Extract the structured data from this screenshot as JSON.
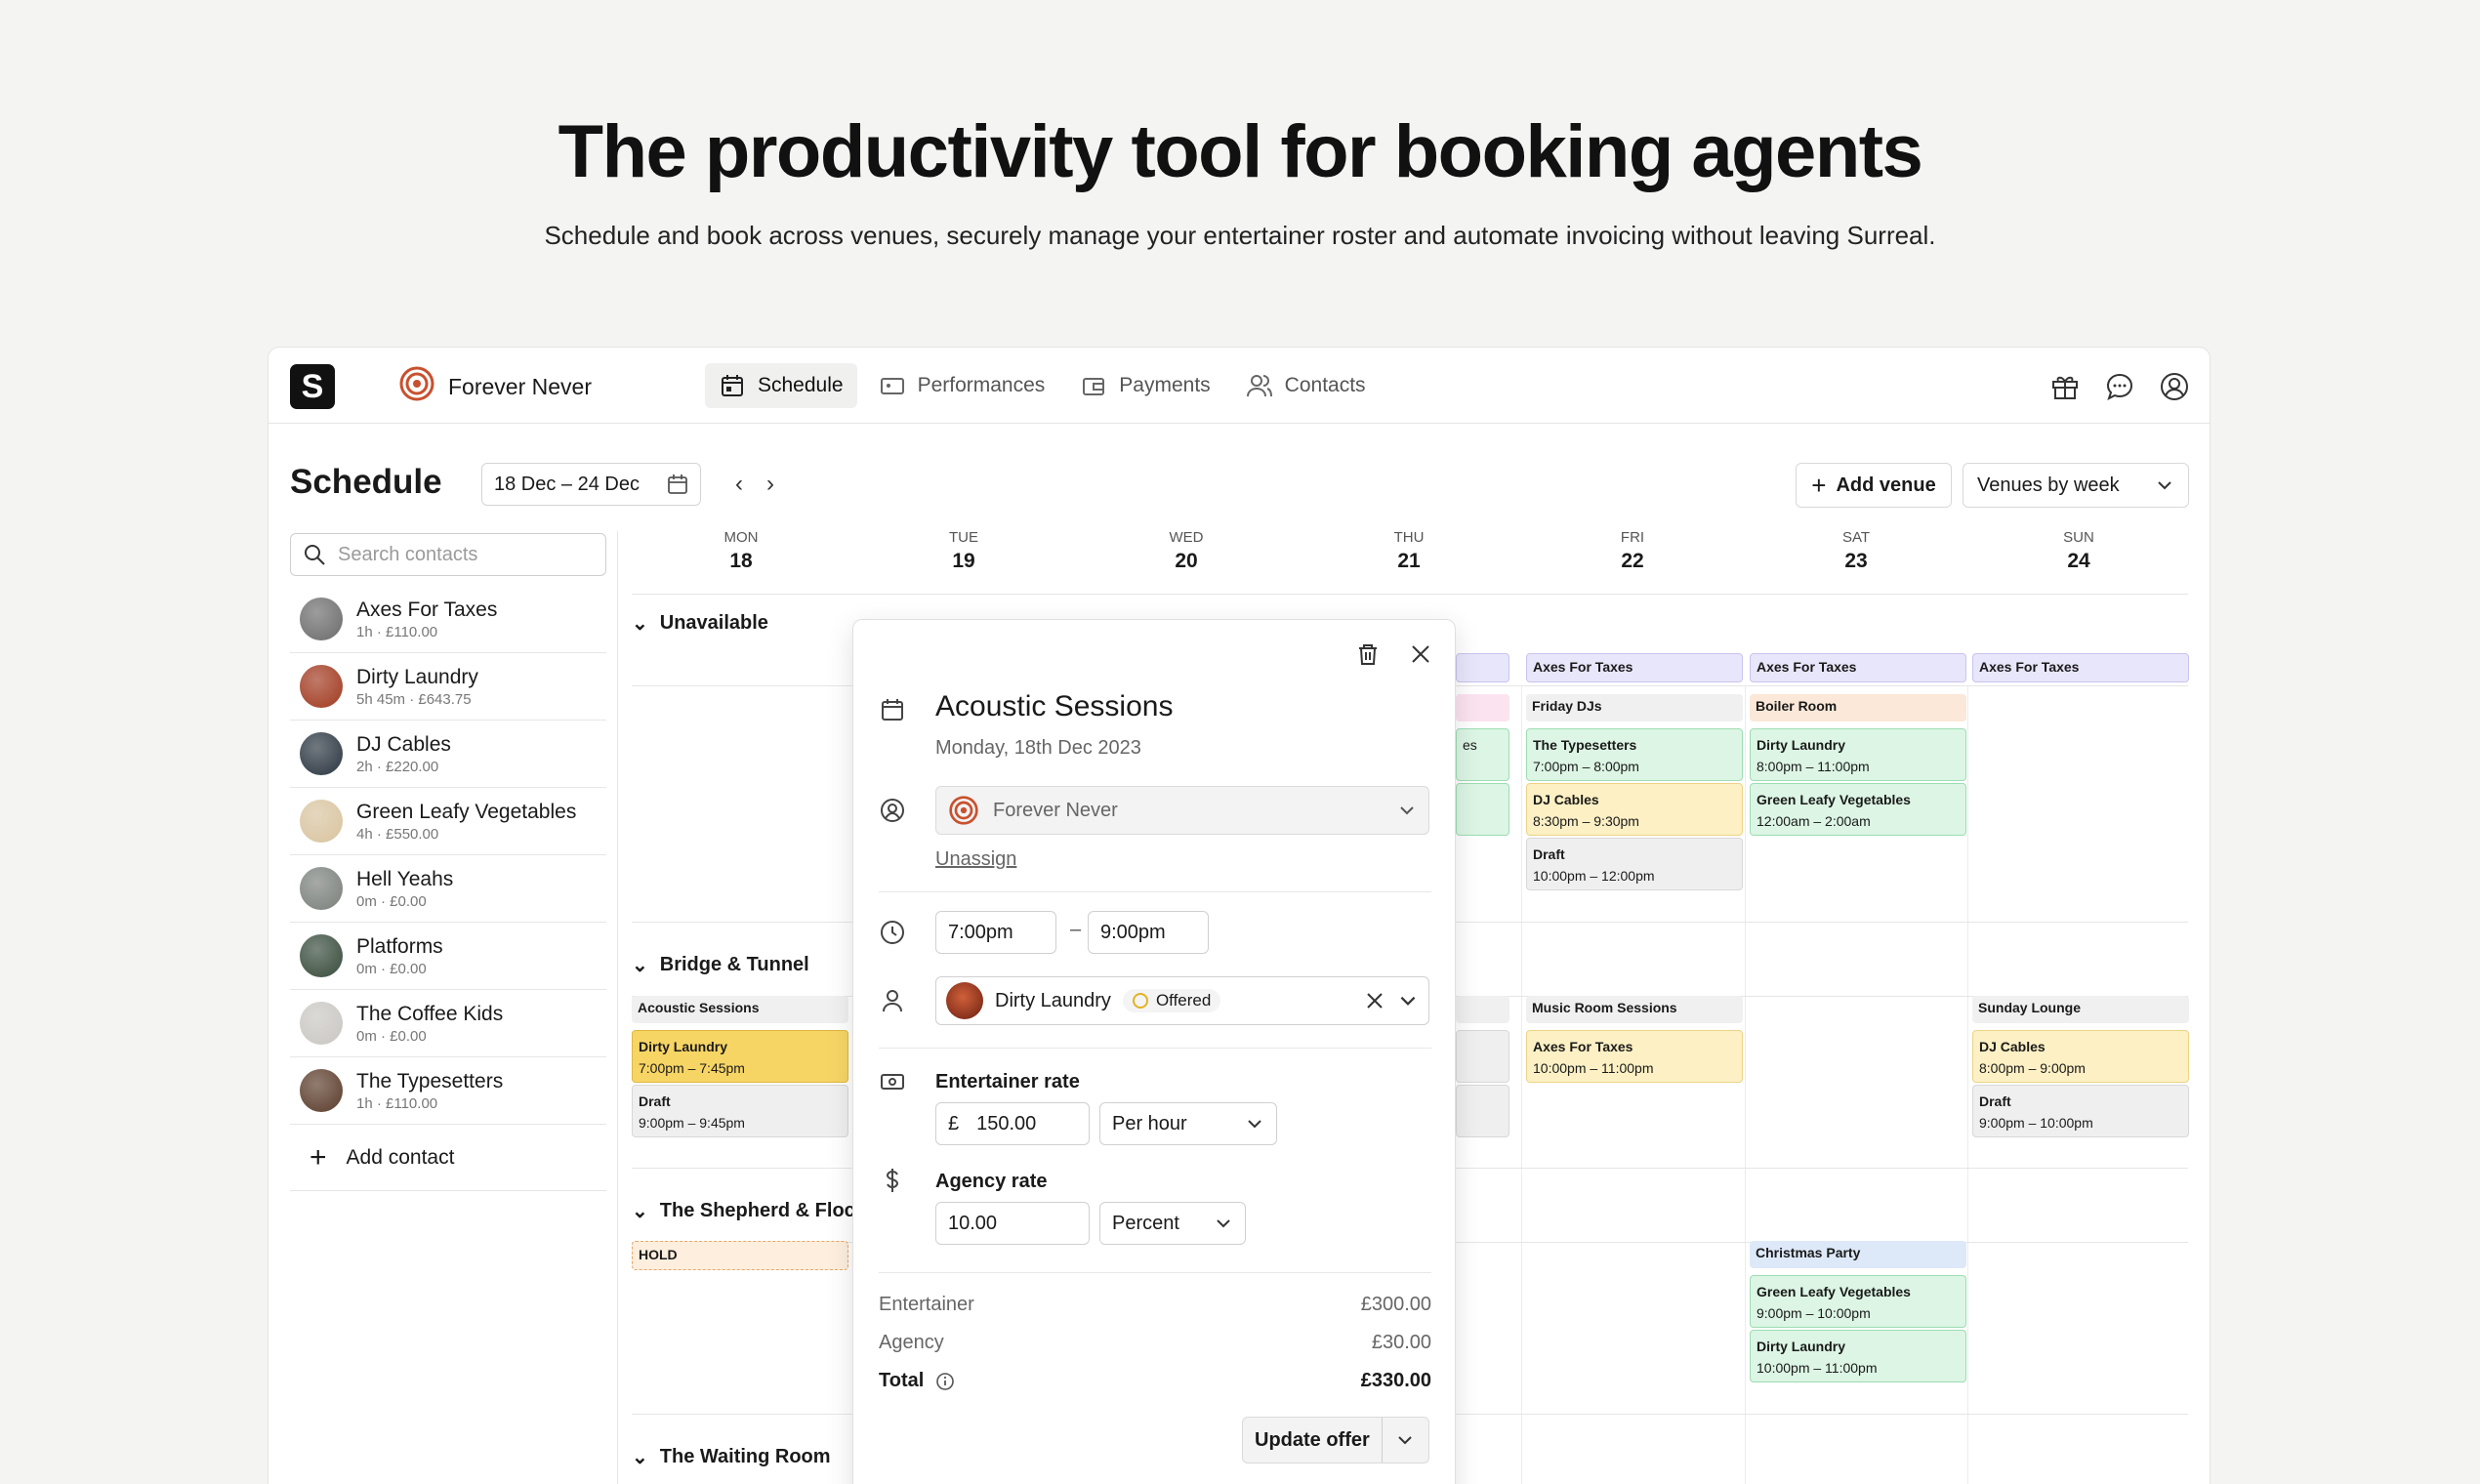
{
  "hero": {
    "title": "The productivity tool for booking agents",
    "subtitle": "Schedule and book across venues, securely manage your entertainer roster and automate invoicing without leaving Surreal."
  },
  "app": {
    "logo_letter": "S",
    "workspace": "Forever Never",
    "nav": [
      {
        "label": "Schedule",
        "icon": "calendar-icon",
        "active": true
      },
      {
        "label": "Performances",
        "icon": "ticket-icon"
      },
      {
        "label": "Payments",
        "icon": "wallet-icon"
      },
      {
        "label": "Contacts",
        "icon": "users-icon"
      }
    ],
    "top_icons": [
      "gift-icon",
      "chat-icon",
      "account-icon"
    ]
  },
  "schedule": {
    "title": "Schedule",
    "date_range": "18 Dec – 24 Dec",
    "add_venue": "Add venue",
    "view": "Venues by week",
    "search_placeholder": "Search contacts",
    "add_contact": "Add contact",
    "contacts": [
      {
        "name": "Axes For Taxes",
        "meta": "1h · £110.00",
        "color": "#6b6b6b"
      },
      {
        "name": "Dirty Laundry",
        "meta": "5h 45m · £643.75",
        "color": "#a0381e"
      },
      {
        "name": "DJ Cables",
        "meta": "2h · £220.00",
        "color": "#2a3540"
      },
      {
        "name": "Green Leafy Vegetables",
        "meta": "4h · £550.00",
        "color": "#d8c39e"
      },
      {
        "name": "Hell Yeahs",
        "meta": "0m · £0.00",
        "color": "#7a7f7a"
      },
      {
        "name": "Platforms",
        "meta": "0m · £0.00",
        "color": "#364a3a"
      },
      {
        "name": "The Coffee Kids",
        "meta": "0m · £0.00",
        "color": "#c9c6c2"
      },
      {
        "name": "The Typesetters",
        "meta": "1h · £110.00",
        "color": "#5a3b2a"
      }
    ],
    "days": [
      {
        "dow": "MON",
        "num": "18"
      },
      {
        "dow": "TUE",
        "num": "19"
      },
      {
        "dow": "WED",
        "num": "20"
      },
      {
        "dow": "THU",
        "num": "21"
      },
      {
        "dow": "FRI",
        "num": "22"
      },
      {
        "dow": "SAT",
        "num": "23"
      },
      {
        "dow": "SUN",
        "num": "24"
      }
    ],
    "sections": [
      "Unavailable",
      "Bridge & Tunnel",
      "The Shepherd & Floc",
      "The Waiting Room"
    ],
    "events": {
      "unavail_thu_partial": "",
      "unavail_fri": "Axes For Taxes",
      "unavail_sat": "Axes For Taxes",
      "unavail_sun": "Axes For Taxes",
      "fri_head": "Friday DJs",
      "fri_1_title": "The Typesetters",
      "fri_1_time": "7:00pm – 8:00pm",
      "fri_2_title": "DJ Cables",
      "fri_2_time": "8:30pm – 9:30pm",
      "fri_3_title": "Draft",
      "fri_3_time": "10:00pm – 12:00pm",
      "thu_partial_text": "es",
      "sat_head": "Boiler Room",
      "sat_1_title": "Dirty Laundry",
      "sat_1_time": "8:00pm – 11:00pm",
      "sat_2_title": "Green Leafy Vegetables",
      "sat_2_time": "12:00am – 2:00am",
      "bt_mon_head": "Acoustic Sessions",
      "bt_mon_1_title": "Dirty Laundry",
      "bt_mon_1_time": "7:00pm – 7:45pm",
      "bt_mon_2_title": "Draft",
      "bt_mon_2_time": "9:00pm – 9:45pm",
      "bt_fri_head": "Music Room Sessions",
      "bt_fri_1_title": "Axes For Taxes",
      "bt_fri_1_time": "10:00pm – 11:00pm",
      "bt_sun_head": "Sunday Lounge",
      "bt_sun_1_title": "DJ Cables",
      "bt_sun_1_time": "8:00pm – 9:00pm",
      "bt_sun_2_title": "Draft",
      "bt_sun_2_time": "9:00pm – 10:00pm",
      "sf_mon_hold": "HOLD",
      "sf_sat_head": "Christmas Party",
      "sf_sat_1_title": "Green Leafy Vegetables",
      "sf_sat_1_time": "9:00pm – 10:00pm",
      "sf_sat_2_title": "Dirty Laundry",
      "sf_sat_2_time": "10:00pm – 11:00pm"
    }
  },
  "panel": {
    "title": "Acoustic Sessions",
    "date": "Monday, 18th Dec 2023",
    "assignee": "Forever Never",
    "unassign": "Unassign",
    "time_start": "7:00pm",
    "time_sep": "–",
    "time_end": "9:00pm",
    "entertainer": "Dirty Laundry",
    "status": "Offered",
    "entertainer_rate_label": "Entertainer rate",
    "currency": "£",
    "entertainer_rate": "150.00",
    "rate_unit": "Per hour",
    "agency_rate_label": "Agency rate",
    "agency_rate": "10.00",
    "agency_unit": "Percent",
    "summary": [
      {
        "label": "Entertainer",
        "value": "£300.00"
      },
      {
        "label": "Agency",
        "value": "£30.00"
      },
      {
        "label": "Total",
        "value": "£330.00"
      }
    ],
    "update_offer": "Update offer"
  }
}
